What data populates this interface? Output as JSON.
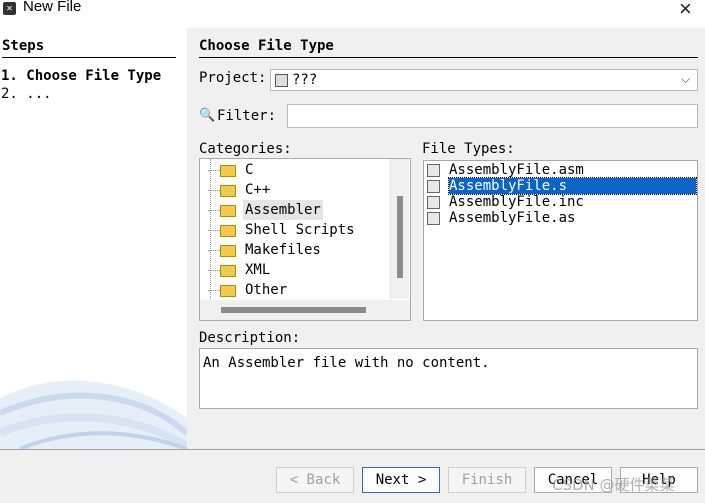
{
  "window": {
    "title": "New File",
    "close_label": "×"
  },
  "steps": {
    "heading": "Steps",
    "items": [
      "1. Choose File Type",
      "2. ..."
    ]
  },
  "main": {
    "heading": "Choose File Type",
    "project_label": "Project:",
    "project_value": "???",
    "filter_label": "Filter:",
    "filter_value": "",
    "categories_label": "Categories:",
    "categories": [
      "C",
      "C++",
      "Assembler",
      "Shell Scripts",
      "Makefiles",
      "XML",
      "Other"
    ],
    "selected_category": "Assembler",
    "file_types_label": "File Types:",
    "file_types": [
      "AssemblyFile.asm",
      "AssemblyFile.s",
      "AssemblyFile.inc",
      "AssemblyFile.as"
    ],
    "selected_file_type": "AssemblyFile.s",
    "description_label": "Description:",
    "description_text": "An Assembler file with no content."
  },
  "buttons": {
    "back": "< Back",
    "next": "Next >",
    "finish": "Finish",
    "cancel": "Cancel",
    "help": "Help"
  },
  "watermark": "CSDN @硬件菜菜",
  "colors": {
    "selection": "#0a64c8",
    "panel_bg": "#f0f0f0",
    "folder": "#f2c94c"
  },
  "icons": {
    "title": "app-icon",
    "close": "close-icon",
    "project": "project-icon",
    "filter": "search-icon",
    "category": "folder-icon",
    "file_type": "file-icon",
    "dropdown": "chevron-down-icon"
  }
}
